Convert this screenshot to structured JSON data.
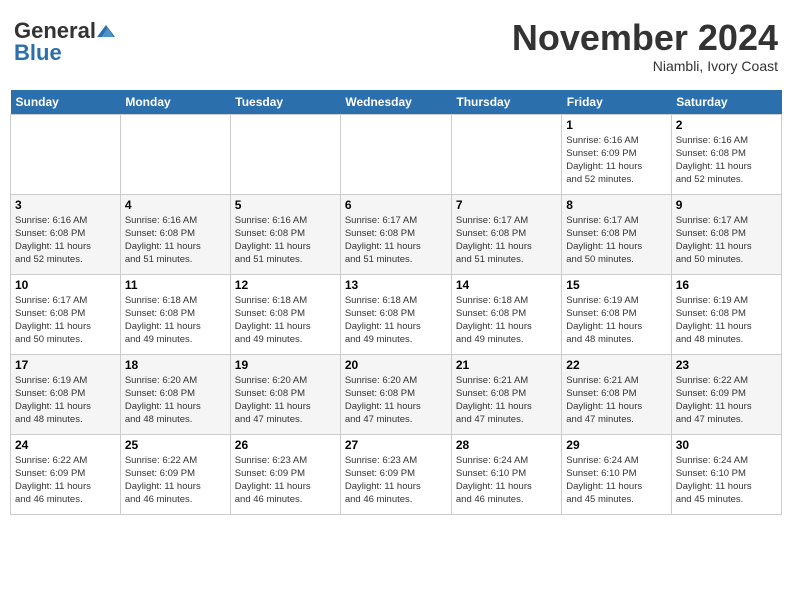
{
  "header": {
    "logo_general": "General",
    "logo_blue": "Blue",
    "month_title": "November 2024",
    "subtitle": "Niambli, Ivory Coast"
  },
  "weekdays": [
    "Sunday",
    "Monday",
    "Tuesday",
    "Wednesday",
    "Thursday",
    "Friday",
    "Saturday"
  ],
  "weeks": [
    [
      {
        "day": "",
        "info": ""
      },
      {
        "day": "",
        "info": ""
      },
      {
        "day": "",
        "info": ""
      },
      {
        "day": "",
        "info": ""
      },
      {
        "day": "",
        "info": ""
      },
      {
        "day": "1",
        "info": "Sunrise: 6:16 AM\nSunset: 6:09 PM\nDaylight: 11 hours\nand 52 minutes."
      },
      {
        "day": "2",
        "info": "Sunrise: 6:16 AM\nSunset: 6:08 PM\nDaylight: 11 hours\nand 52 minutes."
      }
    ],
    [
      {
        "day": "3",
        "info": "Sunrise: 6:16 AM\nSunset: 6:08 PM\nDaylight: 11 hours\nand 52 minutes."
      },
      {
        "day": "4",
        "info": "Sunrise: 6:16 AM\nSunset: 6:08 PM\nDaylight: 11 hours\nand 51 minutes."
      },
      {
        "day": "5",
        "info": "Sunrise: 6:16 AM\nSunset: 6:08 PM\nDaylight: 11 hours\nand 51 minutes."
      },
      {
        "day": "6",
        "info": "Sunrise: 6:17 AM\nSunset: 6:08 PM\nDaylight: 11 hours\nand 51 minutes."
      },
      {
        "day": "7",
        "info": "Sunrise: 6:17 AM\nSunset: 6:08 PM\nDaylight: 11 hours\nand 51 minutes."
      },
      {
        "day": "8",
        "info": "Sunrise: 6:17 AM\nSunset: 6:08 PM\nDaylight: 11 hours\nand 50 minutes."
      },
      {
        "day": "9",
        "info": "Sunrise: 6:17 AM\nSunset: 6:08 PM\nDaylight: 11 hours\nand 50 minutes."
      }
    ],
    [
      {
        "day": "10",
        "info": "Sunrise: 6:17 AM\nSunset: 6:08 PM\nDaylight: 11 hours\nand 50 minutes."
      },
      {
        "day": "11",
        "info": "Sunrise: 6:18 AM\nSunset: 6:08 PM\nDaylight: 11 hours\nand 49 minutes."
      },
      {
        "day": "12",
        "info": "Sunrise: 6:18 AM\nSunset: 6:08 PM\nDaylight: 11 hours\nand 49 minutes."
      },
      {
        "day": "13",
        "info": "Sunrise: 6:18 AM\nSunset: 6:08 PM\nDaylight: 11 hours\nand 49 minutes."
      },
      {
        "day": "14",
        "info": "Sunrise: 6:18 AM\nSunset: 6:08 PM\nDaylight: 11 hours\nand 49 minutes."
      },
      {
        "day": "15",
        "info": "Sunrise: 6:19 AM\nSunset: 6:08 PM\nDaylight: 11 hours\nand 48 minutes."
      },
      {
        "day": "16",
        "info": "Sunrise: 6:19 AM\nSunset: 6:08 PM\nDaylight: 11 hours\nand 48 minutes."
      }
    ],
    [
      {
        "day": "17",
        "info": "Sunrise: 6:19 AM\nSunset: 6:08 PM\nDaylight: 11 hours\nand 48 minutes."
      },
      {
        "day": "18",
        "info": "Sunrise: 6:20 AM\nSunset: 6:08 PM\nDaylight: 11 hours\nand 48 minutes."
      },
      {
        "day": "19",
        "info": "Sunrise: 6:20 AM\nSunset: 6:08 PM\nDaylight: 11 hours\nand 47 minutes."
      },
      {
        "day": "20",
        "info": "Sunrise: 6:20 AM\nSunset: 6:08 PM\nDaylight: 11 hours\nand 47 minutes."
      },
      {
        "day": "21",
        "info": "Sunrise: 6:21 AM\nSunset: 6:08 PM\nDaylight: 11 hours\nand 47 minutes."
      },
      {
        "day": "22",
        "info": "Sunrise: 6:21 AM\nSunset: 6:08 PM\nDaylight: 11 hours\nand 47 minutes."
      },
      {
        "day": "23",
        "info": "Sunrise: 6:22 AM\nSunset: 6:09 PM\nDaylight: 11 hours\nand 47 minutes."
      }
    ],
    [
      {
        "day": "24",
        "info": "Sunrise: 6:22 AM\nSunset: 6:09 PM\nDaylight: 11 hours\nand 46 minutes."
      },
      {
        "day": "25",
        "info": "Sunrise: 6:22 AM\nSunset: 6:09 PM\nDaylight: 11 hours\nand 46 minutes."
      },
      {
        "day": "26",
        "info": "Sunrise: 6:23 AM\nSunset: 6:09 PM\nDaylight: 11 hours\nand 46 minutes."
      },
      {
        "day": "27",
        "info": "Sunrise: 6:23 AM\nSunset: 6:09 PM\nDaylight: 11 hours\nand 46 minutes."
      },
      {
        "day": "28",
        "info": "Sunrise: 6:24 AM\nSunset: 6:10 PM\nDaylight: 11 hours\nand 46 minutes."
      },
      {
        "day": "29",
        "info": "Sunrise: 6:24 AM\nSunset: 6:10 PM\nDaylight: 11 hours\nand 45 minutes."
      },
      {
        "day": "30",
        "info": "Sunrise: 6:24 AM\nSunset: 6:10 PM\nDaylight: 11 hours\nand 45 minutes."
      }
    ]
  ]
}
